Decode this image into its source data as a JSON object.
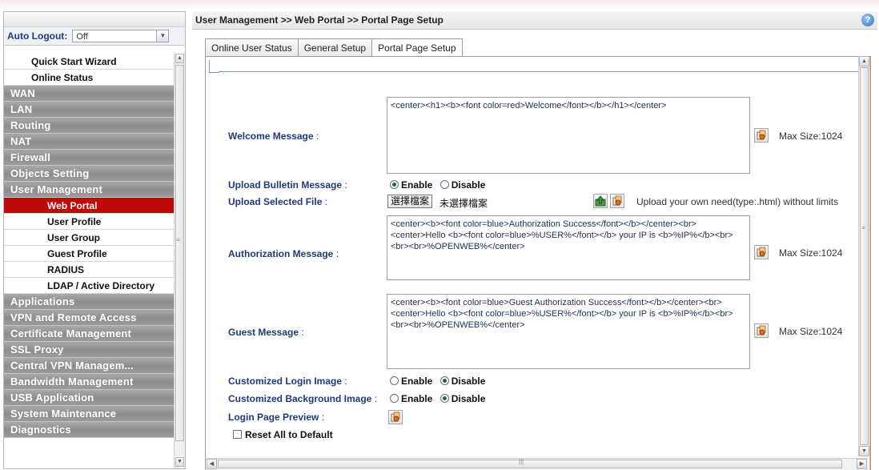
{
  "sidebar": {
    "auto_logout_label": "Auto Logout",
    "auto_logout_colon": " :",
    "auto_logout_value": "Off",
    "items": [
      {
        "label": "Quick Start Wizard",
        "kind": "plain"
      },
      {
        "label": "Online Status",
        "kind": "plain"
      },
      {
        "label": "WAN",
        "kind": "grey"
      },
      {
        "label": "LAN",
        "kind": "grey"
      },
      {
        "label": "Routing",
        "kind": "grey"
      },
      {
        "label": "NAT",
        "kind": "grey"
      },
      {
        "label": "Firewall",
        "kind": "grey"
      },
      {
        "label": "Objects Setting",
        "kind": "grey"
      },
      {
        "label": "User Management",
        "kind": "grey"
      },
      {
        "label": "Web Portal",
        "kind": "active"
      },
      {
        "label": "User Profile",
        "kind": "sub"
      },
      {
        "label": "User Group",
        "kind": "sub"
      },
      {
        "label": "Guest Profile",
        "kind": "sub"
      },
      {
        "label": "RADIUS",
        "kind": "sub"
      },
      {
        "label": "LDAP / Active Directory",
        "kind": "sub"
      },
      {
        "label": "Applications",
        "kind": "grey"
      },
      {
        "label": "VPN and Remote Access",
        "kind": "grey"
      },
      {
        "label": "Certificate Management",
        "kind": "grey"
      },
      {
        "label": "SSL Proxy",
        "kind": "grey"
      },
      {
        "label": "Central VPN Managem...",
        "kind": "grey"
      },
      {
        "label": "Bandwidth Management",
        "kind": "grey"
      },
      {
        "label": "USB Application",
        "kind": "grey"
      },
      {
        "label": "System Maintenance",
        "kind": "grey"
      },
      {
        "label": "Diagnostics",
        "kind": "grey"
      }
    ]
  },
  "header": {
    "breadcrumb": "User Management >> Web Portal >> Portal Page Setup",
    "help_icon": "question-icon"
  },
  "tabs": [
    {
      "label": "Online User Status",
      "active": false
    },
    {
      "label": "General Setup",
      "active": false
    },
    {
      "label": "Portal Page Setup",
      "active": true
    }
  ],
  "form": {
    "welcome_label": "Welcome Message",
    "welcome_text": "<center><h1><b><font color=red>Welcome</font></b></h1></center>",
    "max_size": "Max Size:1024",
    "bulletin_label": "Upload Bulletin Message",
    "enable": "Enable",
    "disable": "Disable",
    "bulletin_value": "Enable",
    "upload_file_label": "Upload Selected File",
    "choose_file": "選擇檔案",
    "no_file": "未選擇檔案",
    "upload_note": "Upload your own need(type:.html) without limits",
    "auth_label": "Authorization Message",
    "auth_text": "<center><b><font color=blue>Authorization Success</font></b></center><br><center>Hello <b><font color=blue>%USER%</font></b> your IP is <b>%IP%</b><br><br><br>%OPENWEB%</center>",
    "guest_label": "Guest Message",
    "guest_text": "<center><b><font color=blue>Guest Authorization Success</font></b></center><br><center>Hello <b><font color=blue>%USER%</font></b> your IP is <b>%IP%</b><br><br><br>%OPENWEB%</center>",
    "login_image_label": "Customized Login Image",
    "login_image_value": "Disable",
    "bg_image_label": "Customized Background Image",
    "bg_image_value": "Disable",
    "preview_label": "Login Page Preview",
    "reset_label": "Reset All to Default",
    "colon": " :"
  },
  "colors": {
    "active_menu": "#c00a0a",
    "grey_menu": "#999999",
    "label_blue": "#1f3a7a",
    "panel_edge": "#f3b47a"
  }
}
